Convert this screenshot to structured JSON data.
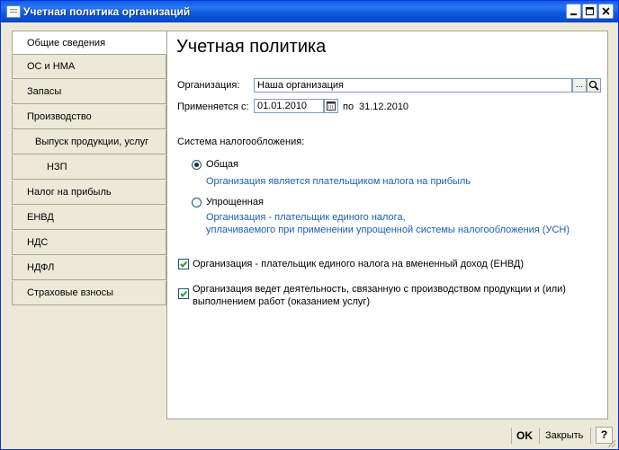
{
  "window": {
    "title": "Учетная политика организаций"
  },
  "nav": {
    "items": [
      {
        "label": "Общие сведения"
      },
      {
        "label": "ОС и НМА"
      },
      {
        "label": "Запасы"
      },
      {
        "label": "Производство"
      },
      {
        "label": "Выпуск продукции, услуг"
      },
      {
        "label": "НЗП"
      },
      {
        "label": "Налог на прибыль"
      },
      {
        "label": "ЕНВД"
      },
      {
        "label": "НДС"
      },
      {
        "label": "НДФЛ"
      },
      {
        "label": "Страховые взносы"
      }
    ]
  },
  "main": {
    "title": "Учетная политика",
    "org_label": "Организация:",
    "org_value": "Наша организация",
    "org_select_btn": "...",
    "applies_label": "Применяется с:",
    "applies_from": "01.01.2010",
    "applies_to_label": "по",
    "applies_to": "31.12.2010",
    "tax_system_label": "Система налогообложения:",
    "radio_general_label": "Общая",
    "radio_general_desc": "Организация является плательщиком налога на прибыль",
    "radio_simple_label": "Упрощенная",
    "radio_simple_desc1": "Организация - плательщик единого налога,",
    "radio_simple_desc2": "уплачиваемого при применении упрощенной системы налогообложения (УСН)",
    "check_envd_label": "Организация - плательщик единого налога на вмененный доход (ЕНВД)",
    "check_prod_label1": "Организация ведет деятельность, связанную с производством  продукции и (или)",
    "check_prod_label2": "выполнением работ (оказанием услуг)"
  },
  "footer": {
    "ok_label": "OK",
    "close_label": "Закрыть",
    "help_label": "?"
  },
  "state": {
    "selected_tax_system": "Общая",
    "envd_checked": true,
    "production_checked": true
  }
}
